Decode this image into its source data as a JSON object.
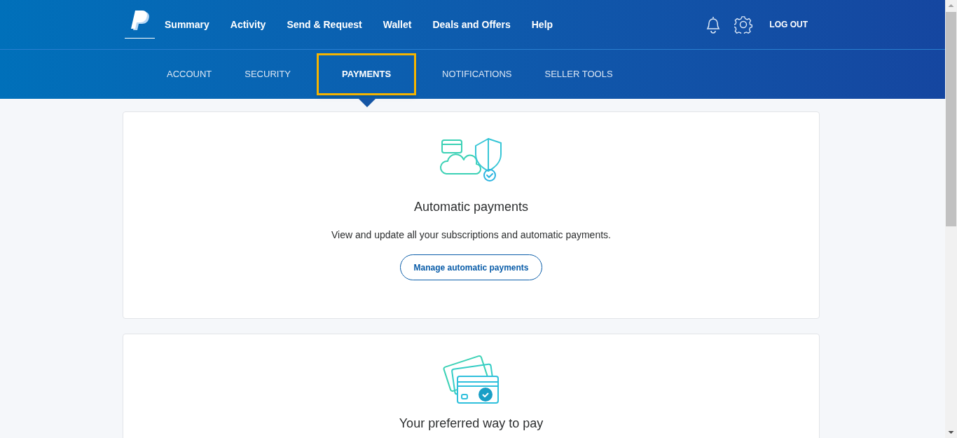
{
  "nav": {
    "items": [
      {
        "label": "Summary"
      },
      {
        "label": "Activity"
      },
      {
        "label": "Send & Request"
      },
      {
        "label": "Wallet"
      },
      {
        "label": "Deals and Offers"
      },
      {
        "label": "Help"
      }
    ],
    "logout": "LOG OUT"
  },
  "subnav": {
    "tabs": [
      {
        "label": "ACCOUNT",
        "selected": false,
        "highlighted": false
      },
      {
        "label": "SECURITY",
        "selected": false,
        "highlighted": false
      },
      {
        "label": "PAYMENTS",
        "selected": true,
        "highlighted": true
      },
      {
        "label": "NOTIFICATIONS",
        "selected": false,
        "highlighted": false
      },
      {
        "label": "SELLER TOOLS",
        "selected": false,
        "highlighted": false
      }
    ]
  },
  "cards": [
    {
      "kind": "autopay",
      "title": "Automatic payments",
      "description": "View and update all your subscriptions and automatic payments.",
      "button": "Manage automatic payments"
    },
    {
      "kind": "cards",
      "title": "Your preferred way to pay"
    }
  ]
}
